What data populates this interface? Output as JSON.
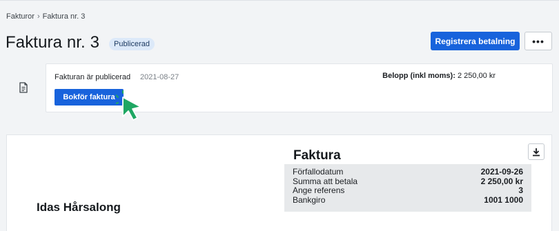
{
  "breadcrumb": {
    "parent": "Fakturor",
    "separator": "›",
    "current": "Faktura nr. 3"
  },
  "header": {
    "title": "Faktura nr. 3",
    "status_badge": "Publicerad",
    "register_payment_label": "Registrera betalning",
    "more_label": "•••"
  },
  "status_card": {
    "text": "Fakturan är publicerad",
    "date": "2021-08-27",
    "amount_label": "Belopp (inkl moms):",
    "amount_value": "2 250,00 kr",
    "book_button_label": "Bokför faktura"
  },
  "invoice": {
    "title": "Faktura",
    "company": "Idas Hårsalong",
    "rows": [
      {
        "label": "Förfallodatum",
        "value": "2021-09-26"
      },
      {
        "label": "Summa att betala",
        "value": "2 250,00 kr"
      },
      {
        "label": "Ange referens",
        "value": "3"
      },
      {
        "label": "Bankgiro",
        "value": "1001 1000"
      }
    ]
  },
  "icons": {
    "document": "document-icon",
    "download": "download-icon",
    "cursor": "pointer-cursor-icon"
  },
  "colors": {
    "primary": "#1863dc",
    "badge_bg": "#dce9f9",
    "cursor": "#1fa763"
  }
}
